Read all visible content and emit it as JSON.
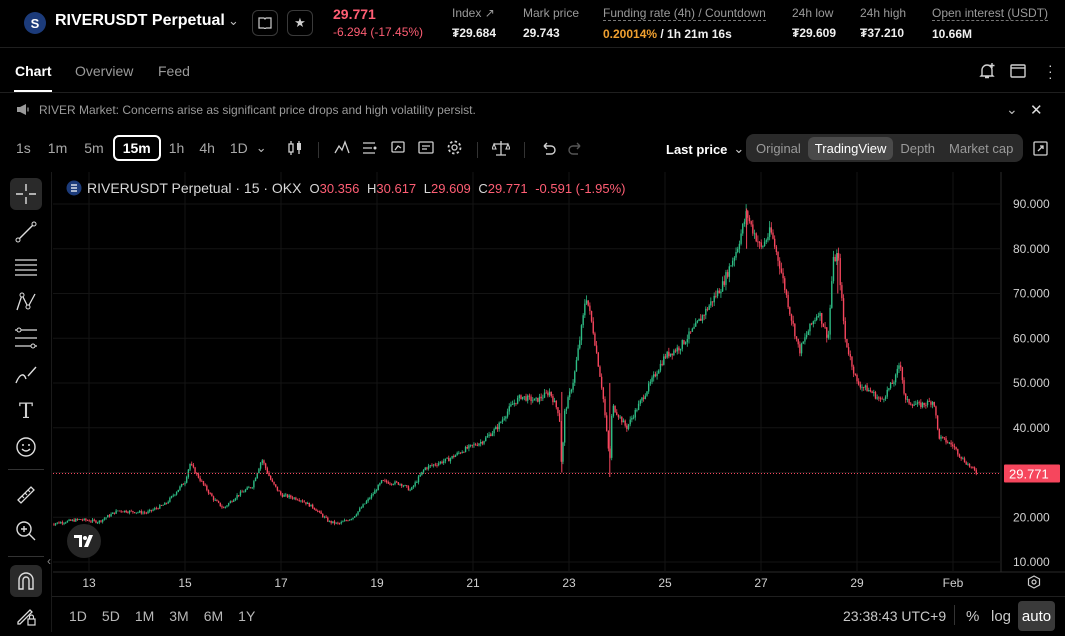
{
  "header": {
    "logo_glyph": "S",
    "symbol": "RIVERUSDT Perpetual",
    "last_price": "29.771",
    "change": "-6.294 (-17.45%)",
    "stats": [
      {
        "label": "Index",
        "value": "₮29.684"
      },
      {
        "label": "Mark price",
        "value": "29.743"
      },
      {
        "label": "Funding rate (4h) / Countdown",
        "value_rate": "0.20014%",
        "value_countdown": " / 1h 21m 16s"
      },
      {
        "label": "24h low",
        "value": "₮29.609"
      },
      {
        "label": "24h high",
        "value": "₮37.210"
      },
      {
        "label": "Open interest (USDT)",
        "value": "10.66M"
      }
    ]
  },
  "tabs": [
    "Chart",
    "Overview",
    "Feed"
  ],
  "news": {
    "text": "RIVER Market: Concerns arise as significant price drops and high volatility persist."
  },
  "toolbar": {
    "timeframes": [
      "1s",
      "1m",
      "5m",
      "15m",
      "1h",
      "4h",
      "1D"
    ],
    "active_timeframe": "15m",
    "price_type": "Last price",
    "views": [
      "Original",
      "TradingView",
      "Depth",
      "Market cap"
    ],
    "active_view": "TradingView"
  },
  "legend": {
    "title": "RIVERUSDT Perpetual · 15 · OKX",
    "o_label": "O",
    "o": "30.356",
    "h_label": "H",
    "h": "30.617",
    "l_label": "L",
    "l": "29.609",
    "c_label": "C",
    "c": "29.771",
    "chg": "-0.591 (-1.95%)"
  },
  "chart_data": {
    "type": "candlestick",
    "y_ticks": [
      "90.000",
      "80.000",
      "70.000",
      "60.000",
      "50.000",
      "40.000",
      "30.000",
      "20.000",
      "10.000"
    ],
    "y_tick_values": [
      90,
      80,
      70,
      60,
      50,
      40,
      30,
      20,
      10
    ],
    "ylim": [
      10,
      90
    ],
    "x_ticks": [
      "13",
      "15",
      "17",
      "19",
      "21",
      "23",
      "25",
      "27",
      "29",
      "Feb"
    ],
    "x_tick_values": [
      13,
      15,
      17,
      19,
      21,
      23,
      25,
      27,
      29,
      31
    ],
    "xlim": [
      12.2,
      31
    ],
    "last_price_label": "29.771",
    "last_price": 29.771,
    "up_color": "#2ebd85",
    "down_color": "#f6465d",
    "close_path": [
      [
        12.2,
        18.5
      ],
      [
        12.8,
        19.5
      ],
      [
        13.2,
        19
      ],
      [
        13.6,
        21.5
      ],
      [
        14.2,
        21
      ],
      [
        14.6,
        23
      ],
      [
        15.0,
        28
      ],
      [
        15.1,
        32
      ],
      [
        15.4,
        27
      ],
      [
        15.6,
        24
      ],
      [
        15.8,
        22
      ],
      [
        16.1,
        25
      ],
      [
        16.4,
        27
      ],
      [
        16.6,
        33
      ],
      [
        16.8,
        28
      ],
      [
        17.0,
        25
      ],
      [
        17.4,
        24
      ],
      [
        17.7,
        22
      ],
      [
        18.0,
        19
      ],
      [
        18.2,
        18.5
      ],
      [
        18.5,
        20
      ],
      [
        18.9,
        25
      ],
      [
        19.1,
        28
      ],
      [
        19.5,
        27.5
      ],
      [
        19.7,
        26
      ],
      [
        20.0,
        31
      ],
      [
        20.5,
        33
      ],
      [
        20.8,
        35
      ],
      [
        21.2,
        37
      ],
      [
        21.5,
        40
      ],
      [
        21.8,
        45
      ],
      [
        22.0,
        47
      ],
      [
        22.3,
        46
      ],
      [
        22.6,
        48
      ],
      [
        22.8,
        43
      ],
      [
        22.85,
        30
      ],
      [
        22.9,
        43
      ],
      [
        23.1,
        51
      ],
      [
        23.3,
        65
      ],
      [
        23.35,
        70
      ],
      [
        23.5,
        62
      ],
      [
        23.7,
        48
      ],
      [
        23.85,
        32
      ],
      [
        23.9,
        45
      ],
      [
        24.2,
        40
      ],
      [
        24.5,
        46
      ],
      [
        24.8,
        52
      ],
      [
        25.0,
        56
      ],
      [
        25.3,
        58
      ],
      [
        25.6,
        62
      ],
      [
        25.9,
        67
      ],
      [
        26.2,
        72
      ],
      [
        26.5,
        80
      ],
      [
        26.7,
        88
      ],
      [
        26.8,
        85
      ],
      [
        27.0,
        80
      ],
      [
        27.2,
        84
      ],
      [
        27.4,
        76
      ],
      [
        27.6,
        66
      ],
      [
        27.8,
        57
      ],
      [
        28.0,
        62
      ],
      [
        28.2,
        66
      ],
      [
        28.4,
        60
      ],
      [
        28.5,
        77
      ],
      [
        28.6,
        79
      ],
      [
        28.75,
        60
      ],
      [
        29.0,
        50
      ],
      [
        29.3,
        48
      ],
      [
        29.5,
        46
      ],
      [
        29.8,
        51
      ],
      [
        29.9,
        55
      ],
      [
        30.0,
        46
      ],
      [
        30.3,
        45
      ],
      [
        30.6,
        46
      ],
      [
        30.7,
        38
      ],
      [
        31.0,
        36
      ],
      [
        31.2,
        33
      ],
      [
        31.5,
        29.8
      ]
    ]
  },
  "bottom": {
    "ranges": [
      "1D",
      "5D",
      "1M",
      "3M",
      "6M",
      "1Y"
    ],
    "time": "23:38:43 UTC+9",
    "percent": "%",
    "log": "log",
    "auto": "auto"
  }
}
